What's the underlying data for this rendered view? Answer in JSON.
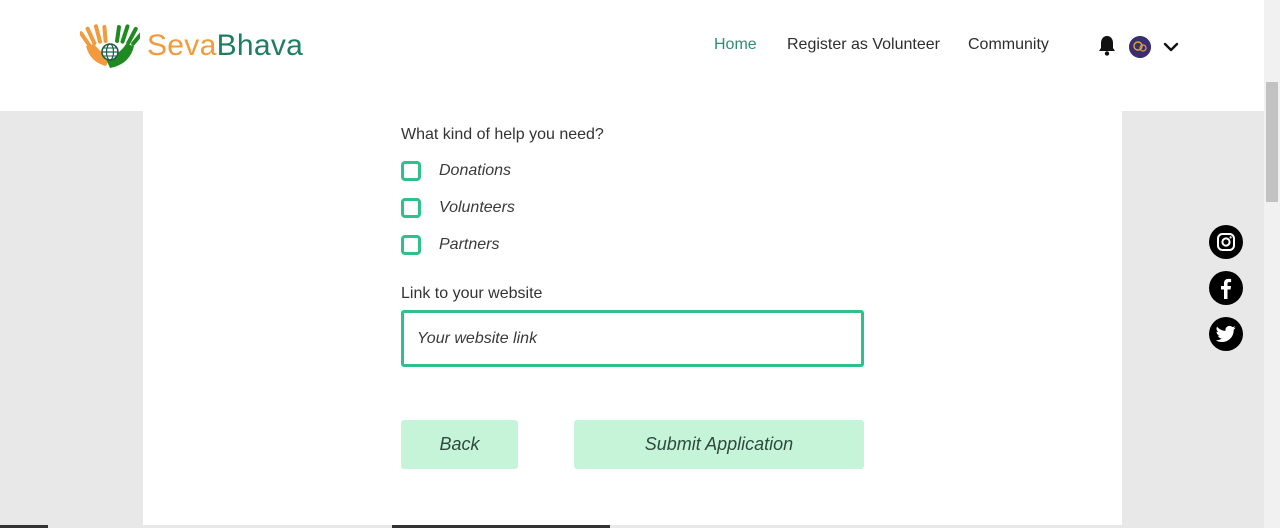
{
  "brand": {
    "name_part1": "Seva",
    "name_part2": "Bhava",
    "color_orange": "#f29a3c",
    "color_green": "#1e7d63"
  },
  "nav": {
    "items": [
      {
        "label": "Home",
        "active": true
      },
      {
        "label": "Register as Volunteer",
        "active": false
      },
      {
        "label": "Community",
        "active": false
      }
    ],
    "icons": [
      "bell-icon",
      "avatar",
      "chevron-down-icon"
    ]
  },
  "form": {
    "help_question": "What kind of help you need?",
    "help_options": [
      {
        "label": "Donations",
        "checked": false
      },
      {
        "label": "Volunteers",
        "checked": false
      },
      {
        "label": "Partners",
        "checked": false
      }
    ],
    "website_label": "Link to your website",
    "website_placeholder": "Your website link",
    "website_value": "",
    "back_label": "Back",
    "submit_label": "Submit Application",
    "accent_color": "#2fc08c",
    "button_color": "#c6f4d8"
  },
  "social": [
    "instagram-icon",
    "facebook-icon",
    "twitter-icon"
  ]
}
